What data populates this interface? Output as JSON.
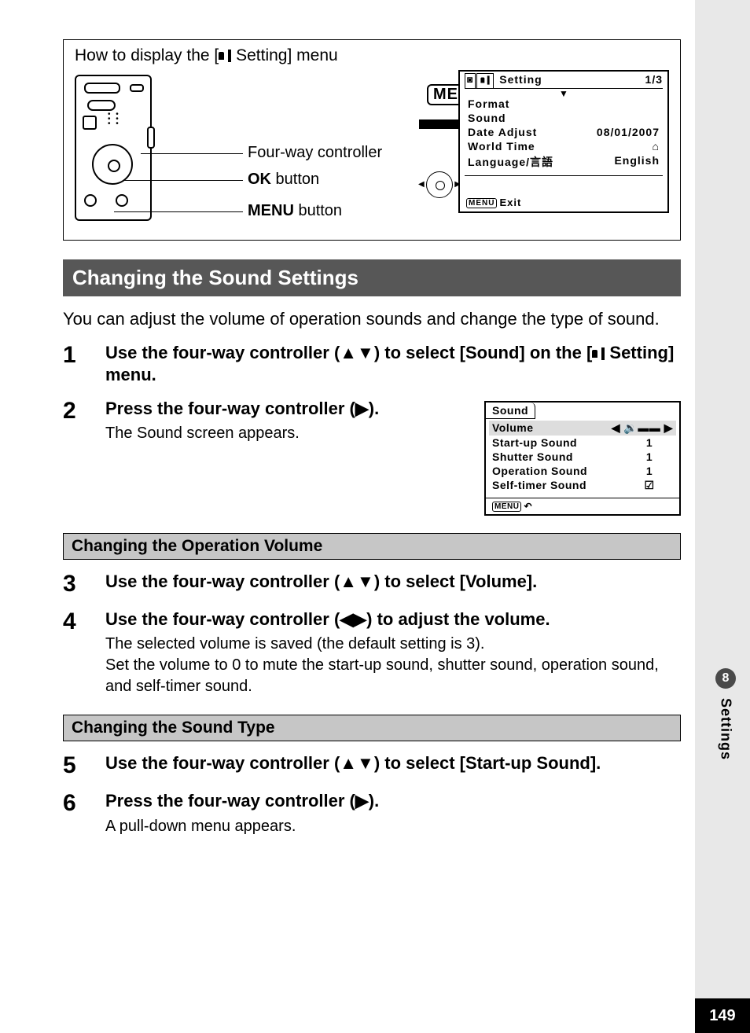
{
  "howto": {
    "title_pre": "How to display the [",
    "title_post": " Setting] menu",
    "label_fourway": "Four-way controller",
    "label_ok_bold": "OK",
    "label_ok_rest": " button",
    "label_menu_bold": "MENU",
    "label_menu_rest": " button",
    "menu_badge": "MENU"
  },
  "lcd1": {
    "title": "Setting",
    "page": "1/3",
    "rows": [
      {
        "label": "Format",
        "value": ""
      },
      {
        "label": "Sound",
        "value": ""
      },
      {
        "label": "Date Adjust",
        "value": "08/01/2007"
      },
      {
        "label": "World Time",
        "value": "⌂"
      },
      {
        "label": "Language/言語",
        "value": "English"
      }
    ],
    "exit_label": "Exit",
    "menu_small": "MENU"
  },
  "section_header": "Changing the Sound Settings",
  "intro": "You can adjust the volume of operation sounds and change the type of sound.",
  "steps": {
    "s1": {
      "num": "1",
      "main_pre": "Use the four-way controller (",
      "main_arrows": "▲▼",
      "main_mid": ") to select [Sound] on the [",
      "main_post": " Setting] menu."
    },
    "s2": {
      "num": "2",
      "main_pre": "Press the four-way controller (",
      "main_arrows": "▶",
      "main_post": ").",
      "sub": "The Sound screen appears."
    },
    "s3": {
      "num": "3",
      "main_pre": "Use the four-way controller (",
      "main_arrows": "▲▼",
      "main_post": ") to select [Volume]."
    },
    "s4": {
      "num": "4",
      "main_pre": "Use the four-way controller (",
      "main_arrows": "◀▶",
      "main_post": ") to adjust the volume.",
      "sub": "The selected volume is saved (the default setting is 3).\nSet the volume to 0 to mute the start-up sound, shutter sound, operation sound, and self-timer sound."
    },
    "s5": {
      "num": "5",
      "main_pre": "Use the four-way controller (",
      "main_arrows": "▲▼",
      "main_post": ") to select [Start-up Sound]."
    },
    "s6": {
      "num": "6",
      "main_pre": "Press the four-way controller (",
      "main_arrows": "▶",
      "main_post": ").",
      "sub": "A pull-down menu appears."
    }
  },
  "sub_hdr_vol": "Changing the Operation Volume",
  "sub_hdr_type": "Changing the Sound Type",
  "sound_lcd": {
    "title": "Sound",
    "rows": [
      {
        "label": "Volume",
        "value": "◀ 🔉▬▬ ▶",
        "hl": true
      },
      {
        "label": "Start-up Sound",
        "value": "1"
      },
      {
        "label": "Shutter Sound",
        "value": "1"
      },
      {
        "label": "Operation Sound",
        "value": "1"
      },
      {
        "label": "Self-timer Sound",
        "value": "☑"
      }
    ],
    "menu_small": "MENU",
    "back_arrow": "↶"
  },
  "side": {
    "num": "8",
    "label": "Settings"
  },
  "page_num": "149"
}
